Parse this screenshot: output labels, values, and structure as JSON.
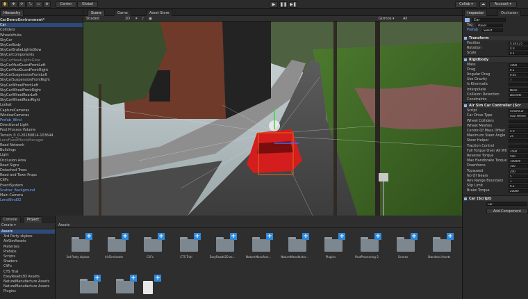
{
  "toolbar": {
    "pivot_label": "Center",
    "space_label": "Global",
    "collab_label": "Collab ▾",
    "account_label": "Account ▾"
  },
  "hierarchy": {
    "tab": "Hierarchy",
    "rows": [
      {
        "text": "CarDemoEnvironment*",
        "bold": true
      },
      {
        "text": "Car",
        "sel": true
      },
      {
        "text": "Colliders"
      },
      {
        "text": "WheelsHubs"
      },
      {
        "text": "SkyCar"
      },
      {
        "text": "SkyCarBody"
      },
      {
        "text": "SkyCarBrakeLightsGlow"
      },
      {
        "text": "SkyCarComponents"
      },
      {
        "text": "SkyCarHeadLightsGlow",
        "dim": true
      },
      {
        "text": "SkyCarMudGuardFrontLeft"
      },
      {
        "text": "SkyCarMudGuardFrontRight"
      },
      {
        "text": "SkyCarSuspensionFrontLeft"
      },
      {
        "text": "SkyCarSuspensionFrontRight"
      },
      {
        "text": "SkyCarWheelFrontLeft"
      },
      {
        "text": "SkyCarWheelFrontRight"
      },
      {
        "text": "SkyCarWheelRearLeft"
      },
      {
        "text": "SkyCarWheelRearRight"
      },
      {
        "text": "Lookat"
      },
      {
        "text": "CaptureCameras"
      },
      {
        "text": "WindowCameras"
      },
      {
        "text": "Prefab_Wind",
        "blue": true
      },
      {
        "text": "Directional Light"
      },
      {
        "text": "Post Process Volume"
      },
      {
        "text": "Terrain_0_0-20180814-103644"
      },
      {
        "text": "LensFlareEffectsManager",
        "dim": true
      },
      {
        "text": "Road Network"
      },
      {
        "text": "Buildings"
      },
      {
        "text": "Light"
      },
      {
        "text": "Occlusion Area"
      },
      {
        "text": "Road Signs"
      },
      {
        "text": "Detached Trees"
      },
      {
        "text": "Road and Town Props"
      },
      {
        "text": "Cliffs"
      },
      {
        "text": "EventSystem"
      },
      {
        "text": "Scatter_Background",
        "blue": true
      },
      {
        "text": "Main Camera"
      },
      {
        "text": "LensWind02",
        "blue": true
      }
    ]
  },
  "scene": {
    "tabs": [
      "Scene",
      "Game",
      "Asset Store"
    ],
    "shading": "Shaded",
    "mode_2d": "2D",
    "gizmos": "Gizmos ▾",
    "search_placeholder": "All"
  },
  "inspector": {
    "tabs": [
      "Inspector",
      "Occlusion"
    ],
    "object_name": "Car",
    "tag_label": "Tag",
    "tag_value": "Player",
    "prefab_label": "Prefab",
    "prefab_select": "Select",
    "transform_title": "Transform",
    "transform": [
      {
        "label": "Position",
        "value": "X 241.25"
      },
      {
        "label": "Rotation",
        "value": "X 0"
      },
      {
        "label": "Scale",
        "value": "X 1"
      }
    ],
    "rigidbody_title": "Rigidbody",
    "rigidbody": [
      {
        "label": "Mass",
        "value": "1000"
      },
      {
        "label": "Drag",
        "value": "0.1"
      },
      {
        "label": "Angular Drag",
        "value": "0.05"
      },
      {
        "label": "Use Gravity",
        "value": "✓"
      },
      {
        "label": "Is Kinematic",
        "value": ""
      },
      {
        "label": "Interpolate",
        "value": "None"
      },
      {
        "label": "Collision Detection",
        "value": "Discrete"
      },
      {
        "label": "Constraints",
        "value": ""
      }
    ],
    "controller_title": "Air Sim Car Controller (Scr",
    "controller": [
      {
        "label": "Script",
        "value": "AirSimCar"
      },
      {
        "label": "Car Drive Type",
        "value": "Four Wheel"
      },
      {
        "label": "Wheel Colliders",
        "value": ""
      },
      {
        "label": "Wheel Meshes",
        "value": ""
      },
      {
        "label": "Centre Of Mass Offset",
        "value": "X 0"
      },
      {
        "label": "Maximum Steer Angle",
        "value": "25"
      },
      {
        "label": "Steer Helper",
        "value": ""
      },
      {
        "label": "Traction Control",
        "value": ""
      },
      {
        "label": "Full Torque Over All Wh",
        "value": "2500"
      },
      {
        "label": "Reverse Torque",
        "value": "500"
      },
      {
        "label": "Max Handbrake Torque",
        "value": "100000"
      },
      {
        "label": "Downforce",
        "value": "100"
      },
      {
        "label": "Topspeed",
        "value": "200"
      },
      {
        "label": "No Of Gears",
        "value": "5"
      },
      {
        "label": "Rev Range Boundary",
        "value": "1"
      },
      {
        "label": "Slip Limit",
        "value": "0.3"
      },
      {
        "label": "Brake Torque",
        "value": "20000"
      }
    ],
    "car_script_title": "Car (Script)",
    "car_script_value": "Car",
    "add_component": "Add Component"
  },
  "bottom": {
    "tabs": [
      "Console",
      "Project"
    ],
    "create_label": "Create ▾",
    "project_tree": [
      {
        "text": "Assets",
        "sel": true
      },
      {
        "text": "3rd Party skybox"
      },
      {
        "text": "AirSimAssets"
      },
      {
        "text": "Materials"
      },
      {
        "text": "Prefabs"
      },
      {
        "text": "Scripts"
      },
      {
        "text": "Shaders"
      },
      {
        "text": "CliFx"
      },
      {
        "text": "CTS Trial"
      },
      {
        "text": "EasyRoads3D Assets"
      },
      {
        "text": "NatureManufacture Assets"
      },
      {
        "text": "NatureManufacture Assets"
      },
      {
        "text": "Plugins"
      }
    ],
    "assets_title": "Assets",
    "folders": [
      "3rd Party skybox",
      "AirSimAssets",
      "CliFx",
      "CTS Trial",
      "EasyRoads3D as...",
      "NatureManufact...",
      "NatureManufactur...",
      "Plugins",
      "PostProcessing-2",
      "Scenes",
      "Standard Assets"
    ]
  },
  "colors": {
    "accent": "#2f89d8",
    "selection": "#2d4a78",
    "car": "#d41d1d",
    "grass": "#4c7a2e"
  }
}
